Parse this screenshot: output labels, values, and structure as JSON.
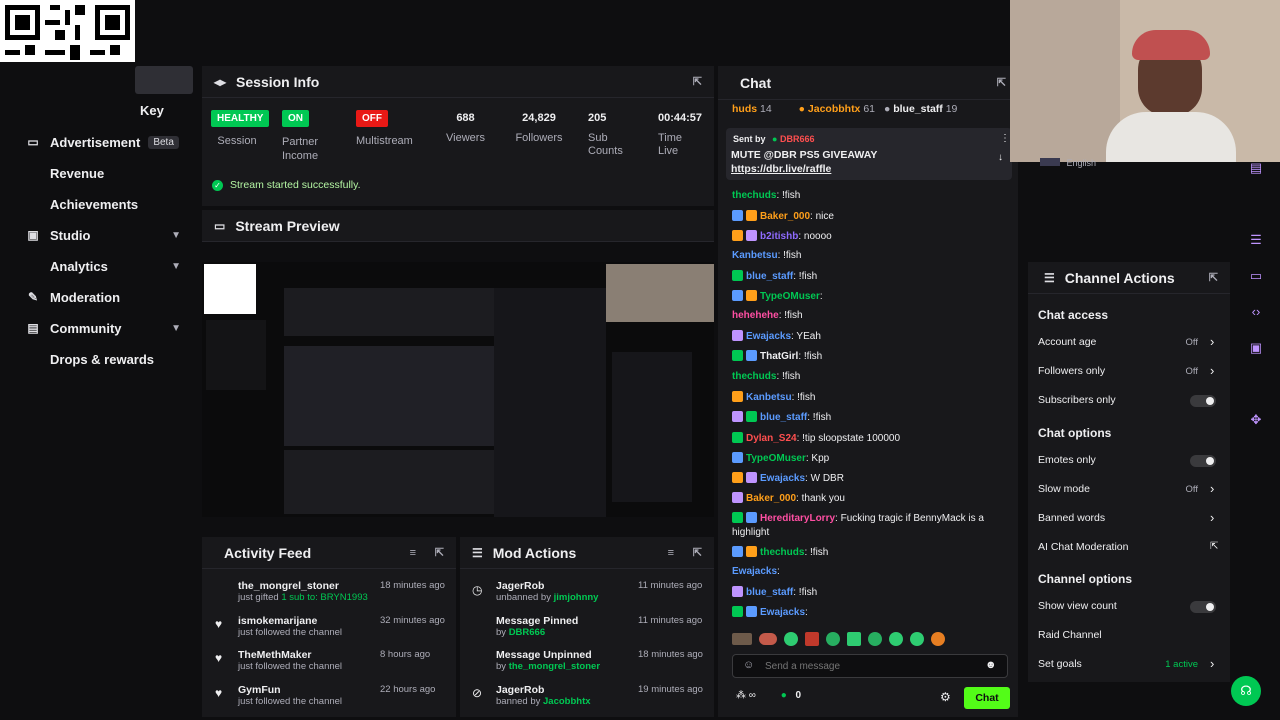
{
  "sidebar": {
    "items": [
      {
        "label": "Key",
        "icon": "key-icon"
      },
      {
        "label": "Advertisement",
        "badge": "Beta",
        "icon": "tv-icon"
      },
      {
        "label": "Revenue",
        "icon": "dollar-icon"
      },
      {
        "label": "Achievements",
        "icon": "trophy-icon"
      },
      {
        "label": "Studio",
        "icon": "video-icon"
      },
      {
        "label": "Analytics",
        "icon": "chart-icon"
      },
      {
        "label": "Moderation",
        "icon": "wrench-icon"
      },
      {
        "label": "Community",
        "icon": "community-icon"
      },
      {
        "label": "Drops & rewards",
        "icon": "gift-icon"
      }
    ]
  },
  "session_info": {
    "title": "Session Info",
    "stats": [
      {
        "pill": "HEALTHY",
        "label": "Session",
        "color": "#00c853"
      },
      {
        "pill": "ON",
        "label": "Partner Income",
        "color": "#00c853"
      },
      {
        "pill": "OFF",
        "label": "Multistream",
        "color": "#e91916"
      },
      {
        "value": "688",
        "label": "Viewers"
      },
      {
        "value": "24,829",
        "label": "Followers"
      },
      {
        "value": "205",
        "label": "Sub Counts"
      },
      {
        "value": "00:44:57",
        "label": "Time Live"
      }
    ],
    "status": "Stream started successfully."
  },
  "stream_preview": {
    "title": "Stream Preview"
  },
  "activity_feed": {
    "title": "Activity Feed",
    "items": [
      {
        "name": "the_mongrel_stoner",
        "sub_a": "just gifted ",
        "sub_b": "1 sub to: ",
        "sub_c": "BRYN1993",
        "time": "18 minutes ago",
        "icon": "gift-icon"
      },
      {
        "name": "ismokemarijane",
        "sub_a": "just followed the channel",
        "time": "32 minutes ago",
        "icon": "heart-icon"
      },
      {
        "name": "TheMethMaker",
        "sub_a": "just followed the channel",
        "time": "8 hours ago",
        "icon": "heart-icon"
      },
      {
        "name": "GymFun",
        "sub_a": "just followed the channel",
        "time": "22 hours ago",
        "icon": "heart-icon"
      }
    ]
  },
  "mod_actions": {
    "title": "Mod Actions",
    "items": [
      {
        "name": "JagerRob",
        "sub_a": "unbanned by ",
        "sub_b": "jimjohnny",
        "time": "11 minutes ago",
        "icon": "clock-icon"
      },
      {
        "name": "Message Pinned",
        "sub_a": "by ",
        "sub_b": "DBR666",
        "time": "11 minutes ago",
        "icon": "pin-icon"
      },
      {
        "name": "Message Unpinned",
        "sub_a": "by ",
        "sub_b": "the_mongrel_stoner",
        "time": "18 minutes ago",
        "icon": "pin-icon"
      },
      {
        "name": "JagerRob",
        "sub_a": "banned by ",
        "sub_b": "Jacobbhtx",
        "time": "19 minutes ago",
        "icon": "ban-icon"
      }
    ]
  },
  "chat": {
    "title": "Chat",
    "top_gifters": [
      {
        "name": "huds",
        "count": "14"
      },
      {
        "name": "Jacobbhtx",
        "count": "61"
      },
      {
        "name": "blue_staff",
        "count": "19"
      }
    ],
    "pinned": {
      "sent_by": "Sent by",
      "sender": "DBR666",
      "text": "MUTE @DBR PS5 GIVEAWAY",
      "link": "https://dbr.live/raffle"
    },
    "messages": [
      {
        "user": "thechuds",
        "text": ": !fish",
        "color": "#00c853"
      },
      {
        "user": "Baker_000",
        "text": ": nice",
        "color": "#ff9f1a"
      },
      {
        "user": "b2itishb",
        "text": ": noooo",
        "color": "#8f6bff"
      },
      {
        "user": "Kanbetsu",
        "text": ": !fish",
        "color": "#5b9bff"
      },
      {
        "user": "blue_staff",
        "text": ": !fish",
        "color": "#5b9bff"
      },
      {
        "user": "TypeOMuser",
        "text": ":",
        "color": "#00c853"
      },
      {
        "user": "hehehehe",
        "text": ": !fish",
        "color": "#ff4fa3"
      },
      {
        "user": "Ewajacks",
        "text": ": YEah",
        "color": "#5b9bff"
      },
      {
        "user": "ThatGirl",
        "text": ": !fish",
        "color": "#efeff1"
      },
      {
        "user": "thechuds",
        "text": ": !fish",
        "color": "#00c853"
      },
      {
        "user": "Kanbetsu",
        "text": ": !fish",
        "color": "#5b9bff"
      },
      {
        "user": "blue_staff",
        "text": ": !fish",
        "color": "#5b9bff"
      },
      {
        "user": "Dylan_S24",
        "text": ": !tip sloopstate 100000",
        "color": "#ff4f4f"
      },
      {
        "user": "TypeOMuser",
        "text": ": Kpp",
        "color": "#00c853"
      },
      {
        "user": "Ewajacks",
        "text": ": W DBR",
        "color": "#5b9bff"
      },
      {
        "user": "Baker_000",
        "text": ": thank you",
        "color": "#ff9f1a"
      },
      {
        "user": "HereditaryLorry",
        "text": ": Fucking tragic if BennyMack is a",
        "text2": "highlight",
        "color": "#ff4fa3"
      },
      {
        "user": "thechuds",
        "text": ": !fish",
        "color": "#00c853"
      },
      {
        "user": "Ewajacks",
        "text": ":",
        "color": "#5b9bff"
      },
      {
        "user": "blue_staff",
        "text": ": !fish",
        "color": "#5b9bff"
      },
      {
        "user": "Ewajacks",
        "text": ":",
        "color": "#5b9bff"
      }
    ],
    "input_placeholder": "Send a message",
    "points": "0",
    "send_label": "Chat"
  },
  "channel_actions": {
    "title": "Channel Actions",
    "language": "English",
    "sections": [
      {
        "title": "Chat access",
        "rows": [
          {
            "label": "Account age",
            "value": "Off",
            "kind": "chevron"
          },
          {
            "label": "Followers only",
            "value": "Off",
            "kind": "chevron"
          },
          {
            "label": "Subscribers only",
            "kind": "toggle"
          }
        ]
      },
      {
        "title": "Chat options",
        "rows": [
          {
            "label": "Emotes only",
            "kind": "toggle"
          },
          {
            "label": "Slow mode",
            "value": "Off",
            "kind": "chevron"
          },
          {
            "label": "Banned words",
            "kind": "chevron"
          },
          {
            "label": "AI Chat Moderation",
            "kind": "external"
          }
        ]
      },
      {
        "title": "Channel options",
        "rows": [
          {
            "label": "Show view count",
            "kind": "toggle"
          },
          {
            "label": "Raid Channel",
            "kind": "none"
          },
          {
            "label": "Set goals",
            "value": "1 active",
            "kind": "chevron"
          }
        ]
      }
    ]
  },
  "colors": {
    "accent": "#53fc18",
    "panel": "#18181b",
    "bg": "#0e0e10",
    "rail": "#bf94ff"
  }
}
